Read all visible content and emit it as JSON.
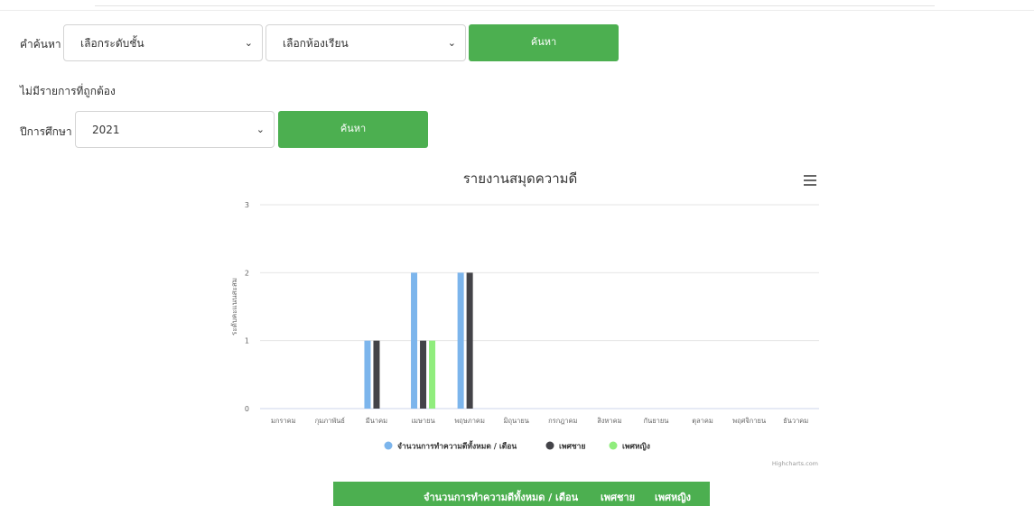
{
  "search": {
    "label": "คำค้นหา :",
    "level_select": "เลือกระดับชั้น",
    "room_select": "เลือกห้องเรียน",
    "button": "ค้นหา"
  },
  "message": "ไม่มีรายการที่ถูกต้อง",
  "year_filter": {
    "label": "ปีการศึกษา :",
    "value": "2021",
    "button": "ค้นหา"
  },
  "chart_data": {
    "type": "bar",
    "title": "รายงานสมุดความดี",
    "ylabel": "ระดับคะแนนสะสม",
    "xlabel": "",
    "ylim": [
      0,
      3
    ],
    "yticks": [
      0,
      1,
      2,
      3
    ],
    "grid": true,
    "legend": "bottom-center",
    "credits": "Highcharts.com",
    "categories": [
      "มกราคม",
      "กุมภาพันธ์",
      "มีนาคม",
      "เมษายน",
      "พฤษภาคม",
      "มิถุนายน",
      "กรกฎาคม",
      "สิงหาคม",
      "กันยายน",
      "ตุลาคม",
      "พฤศจิกายน",
      "ธันวาคม"
    ],
    "series": [
      {
        "name": "จำนวนการทำความดีทั้งหมด / เดือน",
        "color": "#7cb5ec",
        "values": [
          0,
          0,
          1,
          2,
          2,
          0,
          0,
          0,
          0,
          0,
          0,
          0
        ]
      },
      {
        "name": "เพศชาย",
        "color": "#434348",
        "values": [
          0,
          0,
          1,
          1,
          2,
          0,
          0,
          0,
          0,
          0,
          0,
          0
        ]
      },
      {
        "name": "เพศหญิง",
        "color": "#90ed7d",
        "values": [
          0,
          0,
          0,
          1,
          0,
          0,
          0,
          0,
          0,
          0,
          0,
          0
        ]
      }
    ]
  },
  "table": {
    "headers": [
      "จำนวนการทำความดีทั้งหมด / เดือน",
      "เพศชาย",
      "เพศหญิง"
    ]
  }
}
